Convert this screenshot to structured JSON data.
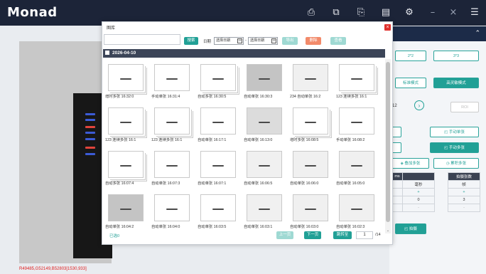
{
  "app": {
    "logo": "Monad"
  },
  "titlebar": {
    "icons": [
      {
        "name": "printer-icon",
        "glyph": "⎙"
      },
      {
        "name": "window-icon",
        "glyph": "⧉"
      },
      {
        "name": "export-file-icon",
        "glyph": "⎘"
      },
      {
        "name": "save-icon",
        "glyph": "▤"
      },
      {
        "name": "gear-icon",
        "glyph": "⚙"
      },
      {
        "name": "minimize-icon",
        "glyph": "–"
      },
      {
        "name": "close-icon",
        "glyph": "×"
      },
      {
        "name": "menu-icon",
        "glyph": "☰"
      }
    ]
  },
  "viewer": {
    "coords": "R49485,G52149,B52803[1530,933]"
  },
  "right_panel": {
    "bin_2x2": "2*2",
    "bin_3x3": "3*3",
    "mode_standard": "标准模式",
    "mode_high_sensitivity": "高灵敏模式",
    "value": "12",
    "roi": "ROI",
    "manual_single": "手动单张",
    "manual_multi": "手动多张",
    "overlay_multi": "叠加多张",
    "accumulate_multi": "累积多张",
    "table": {
      "col_left_header": "ms",
      "col_unit_ms": "毫秒",
      "col_frames_header": "拍摄张数",
      "col_unit_frames": "帧",
      "row_plus_left": "+",
      "row_plus_right": "+",
      "value_left": "0",
      "value_right": "3",
      "row_minus_left": "-",
      "row_minus_right": "-"
    },
    "shoot_button": "拍摄"
  },
  "dialog": {
    "title": "图库",
    "search": {
      "placeholder": "",
      "button": "搜索"
    },
    "date_label": "日期",
    "date_from": "选择日期",
    "date_to": "选择日期",
    "date_sep": "-",
    "cal_glyph": "15",
    "export_button": "导出",
    "delete_button": "删除",
    "view_button": "查看",
    "section_date": "2026-04-10",
    "thumbnails": [
      {
        "label": "增时多张 16:32:0",
        "style": "stack"
      },
      {
        "label": "手动单张 16:31:4",
        "style": "single"
      },
      {
        "label": "自动多张 16:30:5",
        "style": "stack"
      },
      {
        "label": "自动单张 16:30:3",
        "style": "dark"
      },
      {
        "label": "234 自动单张 16:2",
        "style": "light"
      },
      {
        "label": "123 连续多张 16:1",
        "style": "stack"
      },
      {
        "label": "123 连续多张 16:1",
        "style": "stack"
      },
      {
        "label": "123 连续多张 16:1",
        "style": "stack"
      },
      {
        "label": "自动单张 16:17:1",
        "style": "single"
      },
      {
        "label": "自动单张 16:13:0",
        "style": "gray"
      },
      {
        "label": "增时多张 16:08:5",
        "style": "stack"
      },
      {
        "label": "手动单张 16:08:2",
        "style": "single"
      },
      {
        "label": "自动多张 16:07:4",
        "style": "stack"
      },
      {
        "label": "自动单张 16:07:3",
        "style": "single"
      },
      {
        "label": "自动单张 16:07:1",
        "style": "single"
      },
      {
        "label": "自动单张 16:06:5",
        "style": "light"
      },
      {
        "label": "自动单张 16:06:0",
        "style": "light"
      },
      {
        "label": "自动单张 16:05:0",
        "style": "light"
      },
      {
        "label": "自动单张 16:04:2",
        "style": "dark"
      },
      {
        "label": "自动单张 16:04:0",
        "style": "single"
      },
      {
        "label": "自动单张 16:03:5",
        "style": "single"
      },
      {
        "label": "自动单张 16:03:1",
        "style": "light"
      },
      {
        "label": "自动单张 16:03:0",
        "style": "light"
      },
      {
        "label": "自动单张 16:02:3",
        "style": "light"
      }
    ],
    "selected_label": "已选0",
    "prev_button": "上一页",
    "next_button": "下一页",
    "jump_button": "跳转至",
    "page_current": "1",
    "page_total": "/14"
  }
}
